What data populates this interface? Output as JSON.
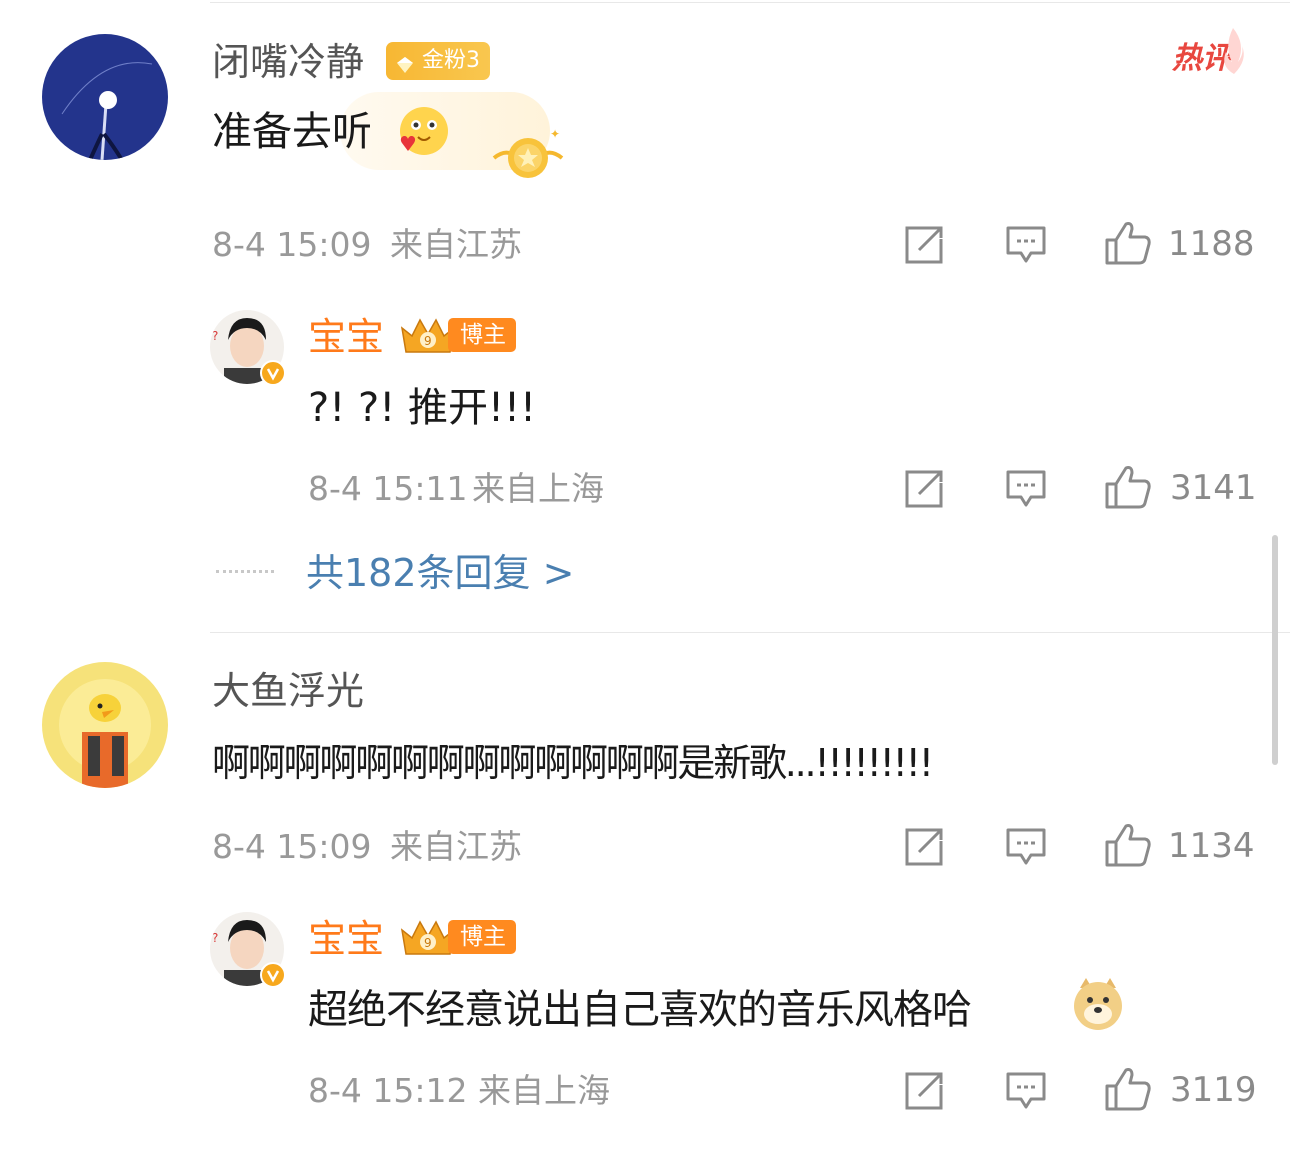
{
  "comments": [
    {
      "user": {
        "name": "闭嘴冷静",
        "badge": "金粉3"
      },
      "hot_label": "热评",
      "text": "准备去听",
      "time": "8-4 15:09",
      "location": "来自江苏",
      "likes": "1188",
      "reply": {
        "user": {
          "name": "宝宝",
          "badge": "博主"
        },
        "text": "?! ?!  推开!!!",
        "time": "8-4 15:11",
        "location": "来自上海",
        "likes": "3141"
      },
      "replies_link": "共182条回复 >"
    },
    {
      "user": {
        "name": "大鱼浮光"
      },
      "text": "啊啊啊啊啊啊啊啊啊啊啊啊啊是新歌...!!!!!!!!!",
      "time": "8-4 15:09",
      "location": "来自江苏",
      "likes": "1134",
      "reply": {
        "user": {
          "name": "宝宝",
          "badge": "博主"
        },
        "text": "超绝不经意说出自己喜欢的音乐风格哈",
        "time": "8-4 15:12",
        "location": "来自上海",
        "likes": "3119"
      }
    }
  ],
  "colors": {
    "accent_orange": "#ff7a1a",
    "link_blue": "#4a7fb0",
    "hot_red": "#e8473f",
    "meta_gray": "#999999"
  }
}
